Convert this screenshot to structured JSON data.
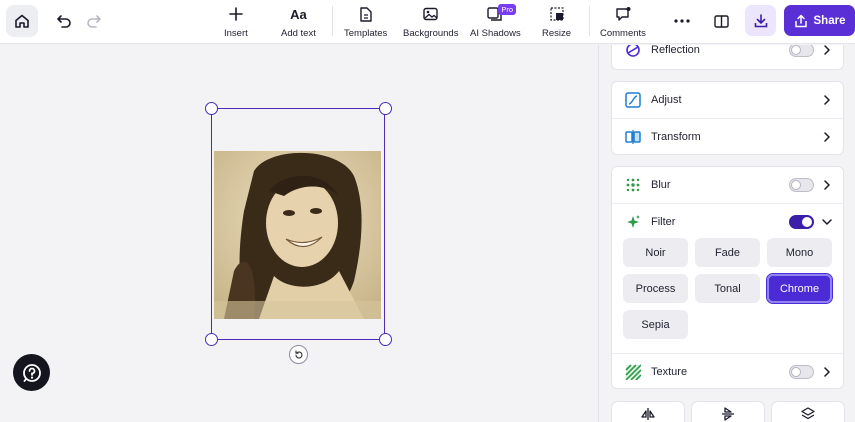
{
  "toolbar": {
    "tools": [
      {
        "label": "Insert",
        "icon": "plus-icon"
      },
      {
        "label": "Add text",
        "icon": "text-aa-icon"
      },
      {
        "label": "Templates",
        "icon": "document-icon"
      },
      {
        "label": "Backgrounds",
        "icon": "image-icon"
      },
      {
        "label": "AI Shadows",
        "icon": "shadow-icon",
        "badge": "Pro"
      },
      {
        "label": "Resize",
        "icon": "resize-icon"
      },
      {
        "label": "Comments",
        "icon": "comment-icon"
      }
    ],
    "share_label": "Share"
  },
  "panel": {
    "reflection_label": "Reflection",
    "adjust_label": "Adjust",
    "transform_label": "Transform",
    "blur_label": "Blur",
    "filter_label": "Filter",
    "texture_label": "Texture",
    "toggles": {
      "reflection": false,
      "blur": false,
      "filter": true,
      "texture": false
    },
    "filters": [
      "Noir",
      "Fade",
      "Mono",
      "Process",
      "Tonal",
      "Chrome",
      "Sepia"
    ],
    "selected_filter": "Chrome"
  },
  "colors": {
    "accent": "#5b2fd6",
    "selection": "#4b2bb8",
    "pro_badge": "#7a3cf0"
  }
}
